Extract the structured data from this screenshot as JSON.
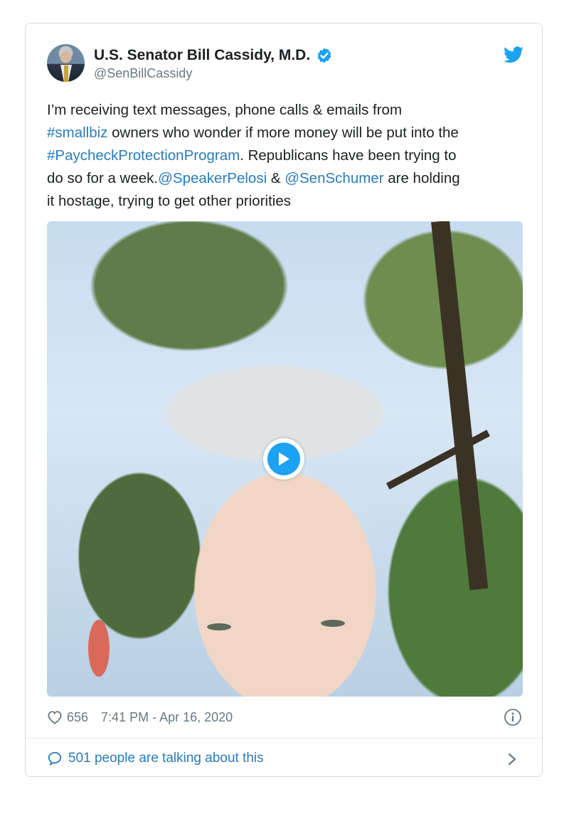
{
  "tweet": {
    "author": {
      "name": "U.S. Senator Bill Cassidy, M.D.",
      "handle": "@SenBillCassidy",
      "verified": true,
      "avatar_icon": "avatar-photo"
    },
    "text": {
      "line1": "I’m receiving text messages, phone calls & emails from",
      "hashtag_smallbiz": "#smallbiz",
      "line2_rest": " owners who wonder if more money will be put into the",
      "hashtag_ppp": "#PaycheckProtectionProgram",
      "line3_rest": ". Republicans have been trying to",
      "line4_start": "do so for a week.",
      "mention_pelosi": "@SpeakerPelosi",
      "amp": " & ",
      "mention_schumer": "@SenSchumer",
      "line4_rest": " are holding",
      "line5": "it hostage, trying to get other priorities"
    },
    "media": {
      "type": "video",
      "play_icon": "play-icon"
    },
    "likes": "656",
    "timestamp": "7:41 PM - Apr 16, 2020",
    "conversation": "501 people are talking about this",
    "colors": {
      "link": "#2b7bb9",
      "brand": "#1da1f2",
      "secondary_text": "#697882"
    }
  }
}
